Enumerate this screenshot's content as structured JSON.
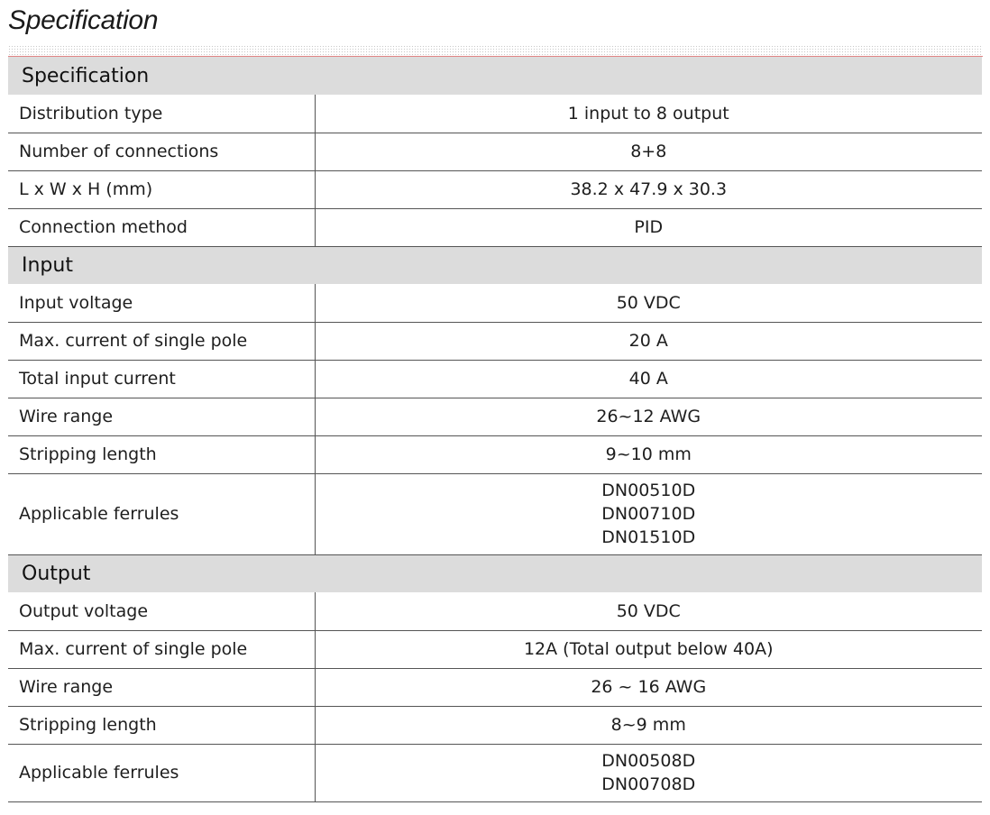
{
  "page": {
    "title": "Specification"
  },
  "sections": [
    {
      "heading": "Specification",
      "rows": [
        {
          "label": "Distribution type",
          "values": [
            "1 input to 8 output"
          ]
        },
        {
          "label": "Number of connections",
          "values": [
            "8+8"
          ]
        },
        {
          "label": "L x W x H (mm)",
          "values": [
            "38.2 x 47.9 x 30.3"
          ]
        },
        {
          "label": "Connection method",
          "values": [
            "PID"
          ]
        }
      ]
    },
    {
      "heading": "Input",
      "rows": [
        {
          "label": "Input voltage",
          "values": [
            "50 VDC"
          ]
        },
        {
          "label": "Max. current of single pole",
          "values": [
            "20 A"
          ]
        },
        {
          "label": "Total input current",
          "values": [
            "40 A"
          ]
        },
        {
          "label": "Wire range",
          "values": [
            "26~12 AWG"
          ]
        },
        {
          "label": "Stripping length",
          "values": [
            "9~10 mm"
          ]
        },
        {
          "label": "Applicable ferrules",
          "values": [
            "DN00510D",
            "DN00710D",
            "DN01510D"
          ]
        }
      ]
    },
    {
      "heading": "Output",
      "rows": [
        {
          "label": "Output voltage",
          "values": [
            "50 VDC"
          ]
        },
        {
          "label": "Max. current of single pole",
          "values": [
            "12A (Total output below 40A)"
          ]
        },
        {
          "label": "Wire range",
          "values": [
            "26 ~ 16 AWG"
          ]
        },
        {
          "label": "Stripping length",
          "values": [
            "8~9 mm"
          ]
        },
        {
          "label": "Applicable ferrules",
          "values": [
            "DN00508D",
            "DN00708D"
          ]
        }
      ]
    }
  ]
}
